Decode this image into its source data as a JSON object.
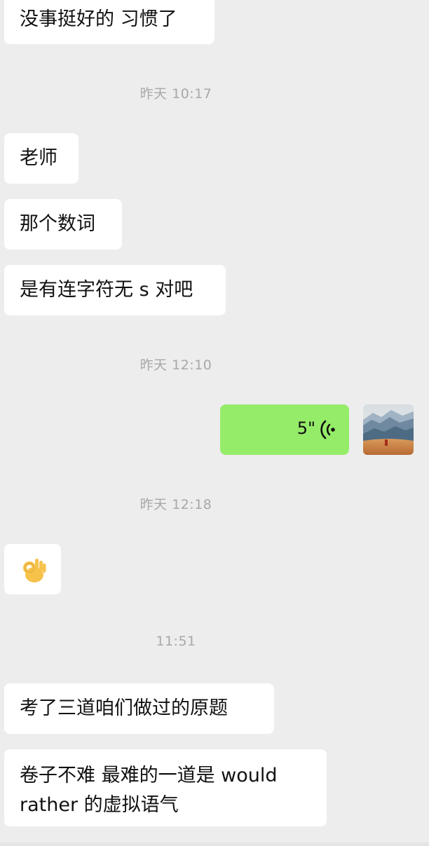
{
  "messages": {
    "m1": "没事挺好的 习惯了",
    "t1": "昨天 10:17",
    "m2": "老师",
    "m3": "那个数词",
    "m4": "是有连字符无 s 对吧",
    "t2": "昨天 12:10",
    "voice_duration": "5\"",
    "t3": "昨天 12:18",
    "t4": "11:51",
    "m5": "考了三道咱们做过的原题",
    "m6": "卷子不难 最难的一道是 would rather 的虚拟语气"
  },
  "icons": {
    "voice": "voice-wave-icon",
    "emoji": "ok-hand-emoji-icon",
    "avatar": "landscape-avatar"
  },
  "colors": {
    "background": "#ededed",
    "incoming_bubble": "#ffffff",
    "outgoing_bubble": "#95ec69",
    "timestamp": "#a8a8a8"
  }
}
